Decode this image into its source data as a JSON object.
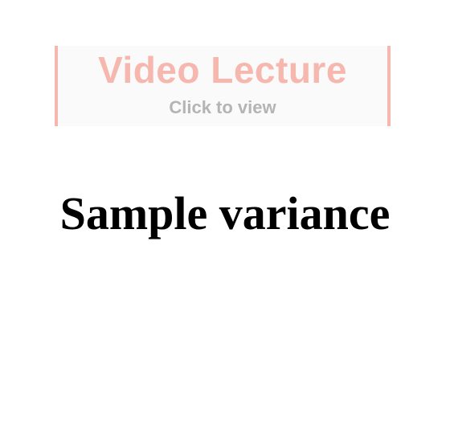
{
  "video_banner": {
    "title": "Video Lecture",
    "subtitle": "Click to view",
    "accent_color": "#f6b7ae",
    "subtitle_color": "#b4b4b4"
  },
  "page": {
    "title": "Sample variance"
  }
}
